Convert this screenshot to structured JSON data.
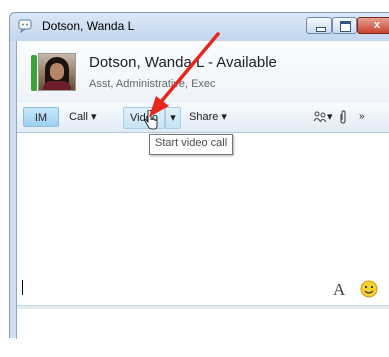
{
  "window": {
    "title": "Dotson, Wanda L",
    "buttons": {
      "minimize": "minimize",
      "maximize": "maximize",
      "close": "x"
    }
  },
  "contact": {
    "name_status": "Dotson, Wanda L - Available",
    "title": "Asst, Administrative, Exec",
    "presence_color": "#3aa33a"
  },
  "toolbar": {
    "im_label": "IM",
    "call_label": "Call ▾",
    "video_label": "Video",
    "video_dropdown": "▾",
    "share_label": "Share ▾",
    "people_label": "▾",
    "more_label": "»"
  },
  "tooltip": {
    "text": "Start video call"
  },
  "compose": {
    "value": ""
  },
  "icons": [
    "app-icon",
    "avatar",
    "people-icon",
    "paperclip-icon",
    "font-icon",
    "smiley-icon",
    "cursor-icon",
    "red-arrow-annotation"
  ],
  "colors": {
    "accent": "#9fd0f2",
    "annotation": "#e8261c"
  }
}
